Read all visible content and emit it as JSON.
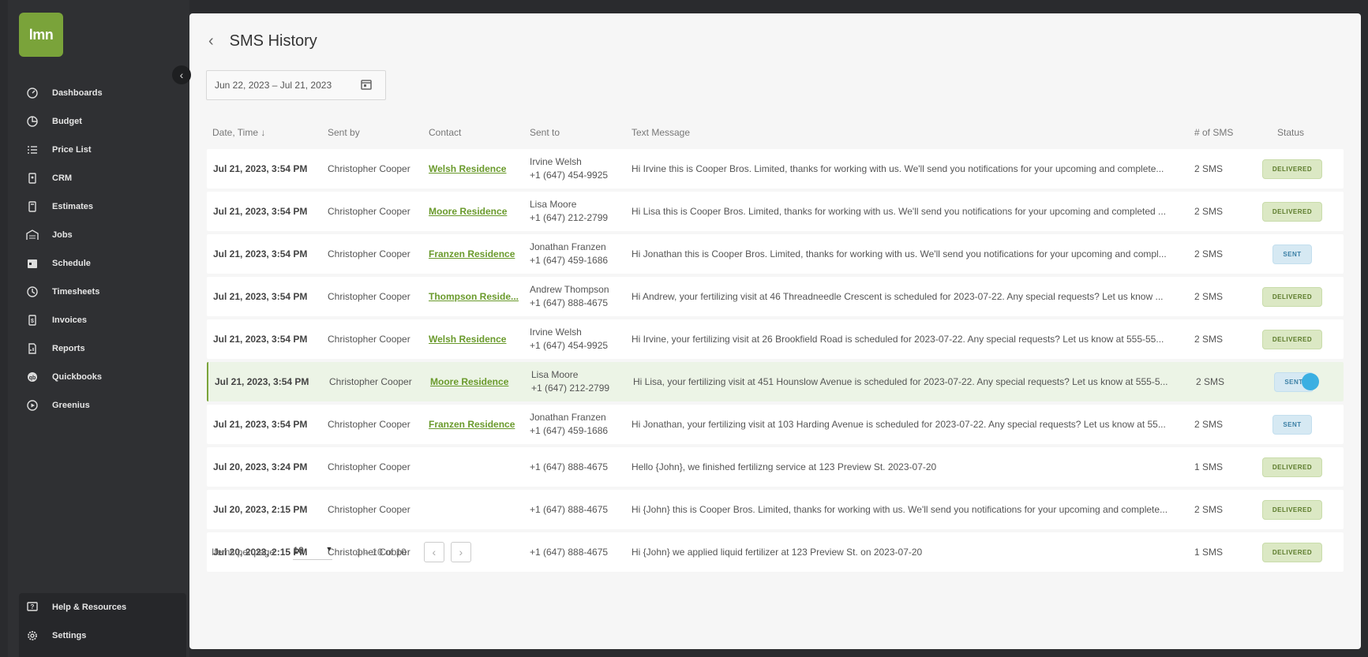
{
  "app": {
    "logo": "lmn"
  },
  "sidebar": {
    "items": [
      {
        "label": "Dashboards",
        "icon": "dashboard-icon"
      },
      {
        "label": "Budget",
        "icon": "pie-chart-icon"
      },
      {
        "label": "Price List",
        "icon": "list-icon"
      },
      {
        "label": "CRM",
        "icon": "contact-card-icon"
      },
      {
        "label": "Estimates",
        "icon": "calculator-icon"
      },
      {
        "label": "Jobs",
        "icon": "building-icon"
      },
      {
        "label": "Schedule",
        "icon": "calendar-icon"
      },
      {
        "label": "Timesheets",
        "icon": "clock-icon"
      },
      {
        "label": "Invoices",
        "icon": "invoice-icon"
      },
      {
        "label": "Reports",
        "icon": "report-icon"
      },
      {
        "label": "Quickbooks",
        "icon": "quickbooks-icon"
      },
      {
        "label": "Greenius",
        "icon": "play-circle-icon"
      }
    ],
    "bottom": [
      {
        "label": "Help & Resources",
        "icon": "help-icon"
      },
      {
        "label": "Settings",
        "icon": "gear-icon"
      }
    ]
  },
  "page": {
    "title": "SMS History",
    "date_range": "Jun 22, 2023 – Jul 21, 2023"
  },
  "table": {
    "headers": {
      "date": "Date, Time",
      "sent_by": "Sent by",
      "contact": "Contact",
      "sent_to": "Sent to",
      "message": "Text Message",
      "count": "# of SMS",
      "status": "Status"
    },
    "rows": [
      {
        "date": "Jul 21, 2023, 3:54 PM",
        "by": "Christopher Cooper",
        "contact": "Welsh Residence",
        "name": "Irvine Welsh",
        "phone": "+1 (647) 454-9925",
        "msg": "Hi Irvine this is Cooper Bros. Limited, thanks for working with us. We'll send you notifications for your upcoming and complete...",
        "count": "2 SMS",
        "status": "DELIVERED"
      },
      {
        "date": "Jul 21, 2023, 3:54 PM",
        "by": "Christopher Cooper",
        "contact": "Moore Residence",
        "name": "Lisa Moore",
        "phone": "+1 (647) 212-2799",
        "msg": "Hi Lisa this is Cooper Bros. Limited, thanks for working with us. We'll send you notifications for your upcoming and completed ...",
        "count": "2 SMS",
        "status": "DELIVERED"
      },
      {
        "date": "Jul 21, 2023, 3:54 PM",
        "by": "Christopher Cooper",
        "contact": "Franzen Residence",
        "name": "Jonathan Franzen",
        "phone": "+1 (647) 459-1686",
        "msg": "Hi Jonathan this is Cooper Bros. Limited, thanks for working with us. We'll send you notifications for your upcoming and compl...",
        "count": "2 SMS",
        "status": "SENT"
      },
      {
        "date": "Jul 21, 2023, 3:54 PM",
        "by": "Christopher Cooper",
        "contact": "Thompson Reside...",
        "name": "Andrew Thompson",
        "phone": "+1 (647) 888-4675",
        "msg": "Hi Andrew, your fertilizing visit at 46 Threadneedle Crescent is scheduled for 2023-07-22. Any special requests? Let us know ...",
        "count": "2 SMS",
        "status": "DELIVERED"
      },
      {
        "date": "Jul 21, 2023, 3:54 PM",
        "by": "Christopher Cooper",
        "contact": "Welsh Residence",
        "name": "Irvine Welsh",
        "phone": "+1 (647) 454-9925",
        "msg": "Hi Irvine, your fertilizing visit at 26 Brookfield Road is scheduled for 2023-07-22. Any special requests? Let us know at 555-55...",
        "count": "2 SMS",
        "status": "DELIVERED"
      },
      {
        "date": "Jul 21, 2023, 3:54 PM",
        "by": "Christopher Cooper",
        "contact": "Moore Residence",
        "name": "Lisa Moore",
        "phone": "+1 (647) 212-2799",
        "msg": "Hi Lisa, your fertilizing visit at 451 Hounslow Avenue is scheduled for 2023-07-22. Any special requests? Let us know at 555-5...",
        "count": "2 SMS",
        "status": "SENT"
      },
      {
        "date": "Jul 21, 2023, 3:54 PM",
        "by": "Christopher Cooper",
        "contact": "Franzen Residence",
        "name": "Jonathan Franzen",
        "phone": "+1 (647) 459-1686",
        "msg": "Hi Jonathan, your fertilizing visit at 103 Harding Avenue is scheduled for 2023-07-22. Any special requests? Let us know at 55...",
        "count": "2 SMS",
        "status": "SENT"
      },
      {
        "date": "Jul 20, 2023, 3:24 PM",
        "by": "Christopher Cooper",
        "contact": "",
        "name": "",
        "phone": "+1 (647) 888-4675",
        "msg": "Hello {John}, we finished fertilizng service at 123 Preview St. 2023-07-20",
        "count": "1 SMS",
        "status": "DELIVERED"
      },
      {
        "date": "Jul 20, 2023, 2:15 PM",
        "by": "Christopher Cooper",
        "contact": "",
        "name": "",
        "phone": "+1 (647) 888-4675",
        "msg": "Hi {John} this is Cooper Bros. Limited, thanks for working with us. We'll send you notifications for your upcoming and complete...",
        "count": "2 SMS",
        "status": "DELIVERED"
      },
      {
        "date": "Jul 20, 2023, 2:15 PM",
        "by": "Christopher Cooper",
        "contact": "",
        "name": "",
        "phone": "+1 (647) 888-4675",
        "msg": "Hi {John} we applied liquid fertilizer at 123 Preview St. on 2023-07-20",
        "count": "1 SMS",
        "status": "DELIVERED"
      }
    ]
  },
  "pagination": {
    "label": "Items per page:",
    "per_page": "10",
    "range": "1 – 10 of 10"
  }
}
